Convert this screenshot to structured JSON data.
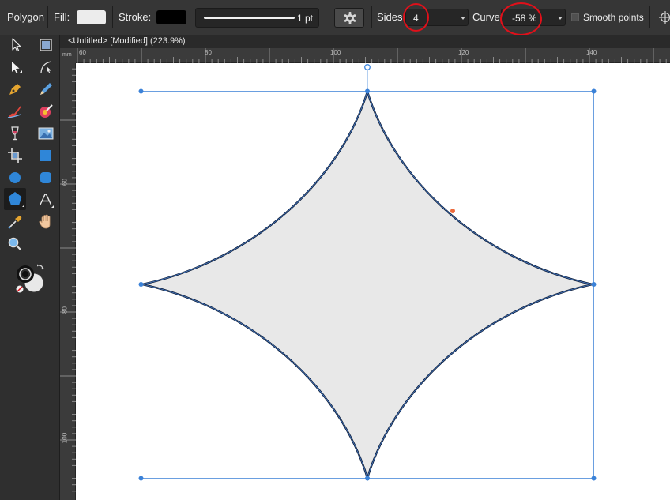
{
  "toolbar": {
    "tool_name": "Polygon",
    "fill_label": "Fill:",
    "stroke_label": "Stroke:",
    "stroke_width": "1 pt",
    "sides_label": "Sides:",
    "sides_value": "4",
    "curve_label": "Curve:",
    "curve_value": "-58 %",
    "smooth_label": "Smooth points",
    "smooth_checked": false,
    "fill_color": "#e8e8e8",
    "stroke_color": "#000000"
  },
  "document": {
    "tab_title": "<Untitled> [Modified] (223.9%)"
  },
  "rulers": {
    "unit": "mm",
    "top_labels": [
      "60",
      "80",
      "100",
      "120",
      "140"
    ],
    "left_labels": [
      "60",
      "80",
      "100"
    ]
  },
  "tools": [
    {
      "name": "move-tool-icon"
    },
    {
      "name": "artboard-tool-icon"
    },
    {
      "name": "node-tool-icon"
    },
    {
      "name": "corner-tool-icon"
    },
    {
      "name": "pen-tool-icon"
    },
    {
      "name": "pencil-tool-icon"
    },
    {
      "name": "vector-brush-tool-icon"
    },
    {
      "name": "fill-tool-icon"
    },
    {
      "name": "transparency-tool-icon"
    },
    {
      "name": "place-image-tool-icon"
    },
    {
      "name": "crop-tool-icon"
    },
    {
      "name": "rectangle-tool-icon"
    },
    {
      "name": "ellipse-tool-icon"
    },
    {
      "name": "rounded-rectangle-tool-icon"
    },
    {
      "name": "polygon-tool-icon",
      "active": true
    },
    {
      "name": "text-tool-icon"
    },
    {
      "name": "color-picker-tool-icon"
    },
    {
      "name": "view-tool-icon"
    },
    {
      "name": "zoom-tool-icon"
    }
  ],
  "colors": {
    "accent": "#4a90d9",
    "selection": "#2f6fd0",
    "shape_fill": "#e8e8e8",
    "annotation": "#e0101a"
  }
}
